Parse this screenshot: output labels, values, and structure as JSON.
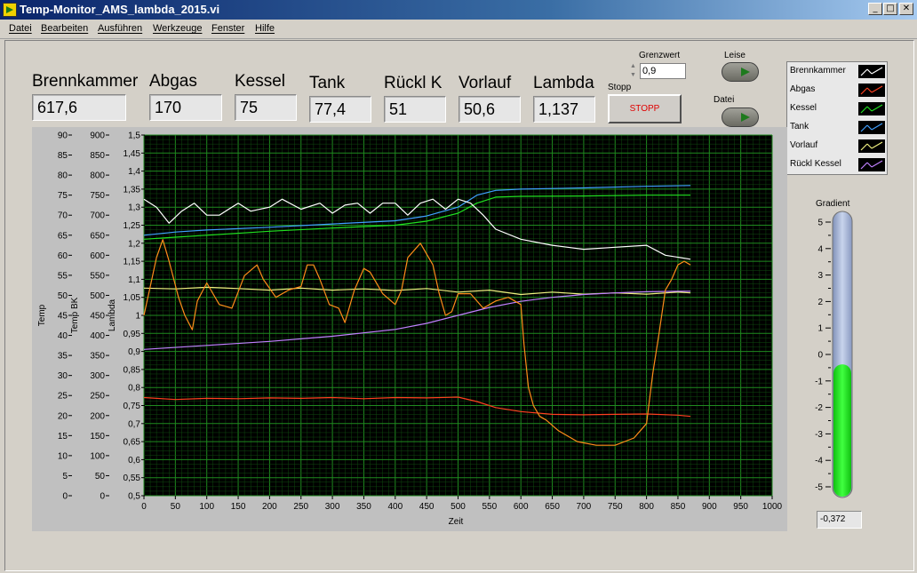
{
  "window": {
    "title": "Temp-Monitor_AMS_lambda_2015.vi"
  },
  "menu": [
    "Datei",
    "Bearbeiten",
    "Ausführen",
    "Werkzeuge",
    "Fenster",
    "Hilfe"
  ],
  "indicators": [
    {
      "label": "Brennkammer",
      "value": "617,6"
    },
    {
      "label": "Abgas",
      "value": "170"
    },
    {
      "label": "Kessel",
      "value": "75"
    },
    {
      "label": "Tank",
      "value": "77,4"
    },
    {
      "label": "Rückl K",
      "value": "51"
    },
    {
      "label": "Vorlauf",
      "value": "50,6"
    },
    {
      "label": "Lambda",
      "value": "1,137"
    }
  ],
  "controls": {
    "grenzwert_label": "Grenzwert",
    "grenzwert_value": "0,9",
    "stopp_label": "Stopp",
    "stopp_button": "STOPP",
    "leise_label": "Leise",
    "datei_label": "Datei"
  },
  "legend": [
    {
      "name": "Brennkammer",
      "color": "#ffffff"
    },
    {
      "name": "Abgas",
      "color": "#ff4020"
    },
    {
      "name": "Kessel",
      "color": "#20e020"
    },
    {
      "name": "Tank",
      "color": "#40a0ff"
    },
    {
      "name": "Vorlauf",
      "color": "#f0f080"
    },
    {
      "name": "Rückl Kessel",
      "color": "#c080ff"
    }
  ],
  "gradient": {
    "label": "Gradient",
    "value": "-0,372",
    "reading": -0.372,
    "min": -5,
    "max": 5,
    "ticks": [
      "5",
      "4",
      "3",
      "2",
      "1",
      "0",
      "-1",
      "-2",
      "-3",
      "-4",
      "-5"
    ]
  },
  "chart_data": {
    "type": "line",
    "xlabel": "Zeit",
    "xlim": [
      0,
      1000
    ],
    "xticks": [
      "0",
      "50",
      "100",
      "150",
      "200",
      "250",
      "300",
      "350",
      "400",
      "450",
      "500",
      "550",
      "600",
      "650",
      "700",
      "750",
      "800",
      "850",
      "900",
      "950",
      "1000"
    ],
    "axes": [
      {
        "label": "Temp",
        "ylim": [
          0,
          90
        ],
        "ticks": [
          "90",
          "85",
          "80",
          "75",
          "70",
          "65",
          "60",
          "55",
          "50",
          "45",
          "40",
          "35",
          "30",
          "25",
          "20",
          "15",
          "10",
          "5",
          "0"
        ]
      },
      {
        "label": "Temp BK",
        "ylim": [
          0,
          900
        ],
        "ticks": [
          "900",
          "850",
          "800",
          "750",
          "700",
          "650",
          "600",
          "550",
          "500",
          "450",
          "400",
          "350",
          "300",
          "250",
          "200",
          "150",
          "100",
          "50",
          "0"
        ]
      },
      {
        "label": "Lambda",
        "ylim": [
          0.5,
          1.5
        ],
        "ticks": [
          "1,5",
          "1,45",
          "1,4",
          "1,35",
          "1,3",
          "1,25",
          "1,2",
          "1,15",
          "1,1",
          "1,05",
          "1",
          "0,95",
          "0,9",
          "0,85",
          "0,8",
          "0,75",
          "0,7",
          "0,65",
          "0,6",
          "0,55",
          "0,5"
        ]
      }
    ],
    "grid": true,
    "series": [
      {
        "key": "tank",
        "axis": "Temp",
        "color": "#40a0ff",
        "x": [
          0,
          50,
          100,
          200,
          300,
          400,
          450,
          500,
          530,
          560,
          600,
          700,
          800,
          870
        ],
        "y": [
          65,
          65.8,
          66.3,
          67,
          67.8,
          68.6,
          69.8,
          72,
          75,
          76.2,
          76.5,
          76.8,
          77.2,
          77.4
        ]
      },
      {
        "key": "kessel",
        "axis": "Temp",
        "color": "#20e020",
        "x": [
          0,
          50,
          100,
          200,
          300,
          400,
          450,
          500,
          530,
          560,
          600,
          700,
          800,
          870
        ],
        "y": [
          64,
          64.5,
          65,
          66,
          66.8,
          67.5,
          68.5,
          70.5,
          73,
          74.5,
          74.7,
          74.8,
          75,
          75
        ]
      },
      {
        "key": "brennkammer",
        "axis": "Temp BK",
        "color": "#ffffff",
        "x": [
          0,
          20,
          40,
          60,
          80,
          100,
          120,
          150,
          170,
          200,
          220,
          250,
          280,
          300,
          320,
          340,
          360,
          380,
          400,
          420,
          440,
          460,
          480,
          500,
          520,
          540,
          560,
          600,
          650,
          700,
          750,
          800,
          830,
          870
        ],
        "y": [
          740,
          720,
          680,
          710,
          730,
          700,
          700,
          730,
          710,
          720,
          740,
          715,
          730,
          705,
          725,
          730,
          705,
          730,
          730,
          700,
          730,
          740,
          715,
          740,
          730,
          700,
          665,
          640,
          625,
          615,
          620,
          625,
          600,
          590
        ]
      },
      {
        "key": "vorlauf",
        "axis": "Temp",
        "color": "#f0f080",
        "x": [
          0,
          50,
          100,
          150,
          200,
          250,
          300,
          350,
          400,
          450,
          500,
          550,
          600,
          650,
          700,
          750,
          800,
          850,
          870
        ],
        "y": [
          51.8,
          51.6,
          52,
          51.7,
          51.3,
          51.8,
          51.3,
          51.6,
          51.2,
          51.7,
          50.8,
          51.3,
          50.2,
          50.8,
          50.3,
          50.6,
          50.3,
          50.8,
          50.6
        ]
      },
      {
        "key": "rueckl_kessel",
        "axis": "Temp",
        "color": "#c080ff",
        "x": [
          0,
          100,
          200,
          300,
          400,
          450,
          500,
          550,
          600,
          650,
          700,
          750,
          800,
          850,
          870
        ],
        "y": [
          36.5,
          37.5,
          38.5,
          39.8,
          41.5,
          43,
          45,
          47,
          48.5,
          49.5,
          50.2,
          50.6,
          50.9,
          51,
          51
        ]
      },
      {
        "key": "abgas",
        "axis": "Temp",
        "color": "#ff4020",
        "x": [
          0,
          50,
          100,
          150,
          200,
          250,
          300,
          350,
          400,
          450,
          500,
          530,
          560,
          600,
          650,
          700,
          750,
          800,
          850,
          870
        ],
        "y": [
          24.5,
          24,
          24.3,
          24.2,
          24.4,
          24.3,
          24.5,
          24.2,
          24.5,
          24.4,
          24.6,
          23.5,
          22,
          21,
          20.3,
          20.2,
          20.3,
          20.4,
          20.1,
          19.8
        ]
      },
      {
        "key": "lambda",
        "axis": "Lambda",
        "color": "#ff8c1a",
        "x": [
          0,
          10,
          20,
          30,
          40,
          55,
          65,
          77,
          85,
          100,
          120,
          140,
          160,
          180,
          190,
          210,
          230,
          250,
          260,
          270,
          280,
          295,
          310,
          320,
          335,
          350,
          360,
          380,
          400,
          410,
          420,
          440,
          460,
          470,
          480,
          490,
          500,
          520,
          540,
          560,
          580,
          600,
          605,
          612,
          620,
          630,
          640,
          660,
          690,
          720,
          750,
          780,
          800,
          810,
          820,
          830,
          840,
          850,
          860,
          870
        ],
        "y": [
          1.0,
          1.08,
          1.16,
          1.21,
          1.15,
          1.05,
          1.0,
          0.96,
          1.04,
          1.09,
          1.03,
          1.02,
          1.11,
          1.14,
          1.1,
          1.05,
          1.07,
          1.08,
          1.14,
          1.14,
          1.1,
          1.03,
          1.02,
          0.98,
          1.07,
          1.13,
          1.12,
          1.06,
          1.03,
          1.07,
          1.16,
          1.2,
          1.14,
          1.06,
          1.0,
          1.01,
          1.06,
          1.06,
          1.02,
          1.04,
          1.05,
          1.03,
          0.92,
          0.8,
          0.75,
          0.72,
          0.71,
          0.68,
          0.65,
          0.64,
          0.64,
          0.66,
          0.7,
          0.84,
          0.95,
          1.07,
          1.1,
          1.14,
          1.15,
          1.14
        ]
      }
    ]
  }
}
